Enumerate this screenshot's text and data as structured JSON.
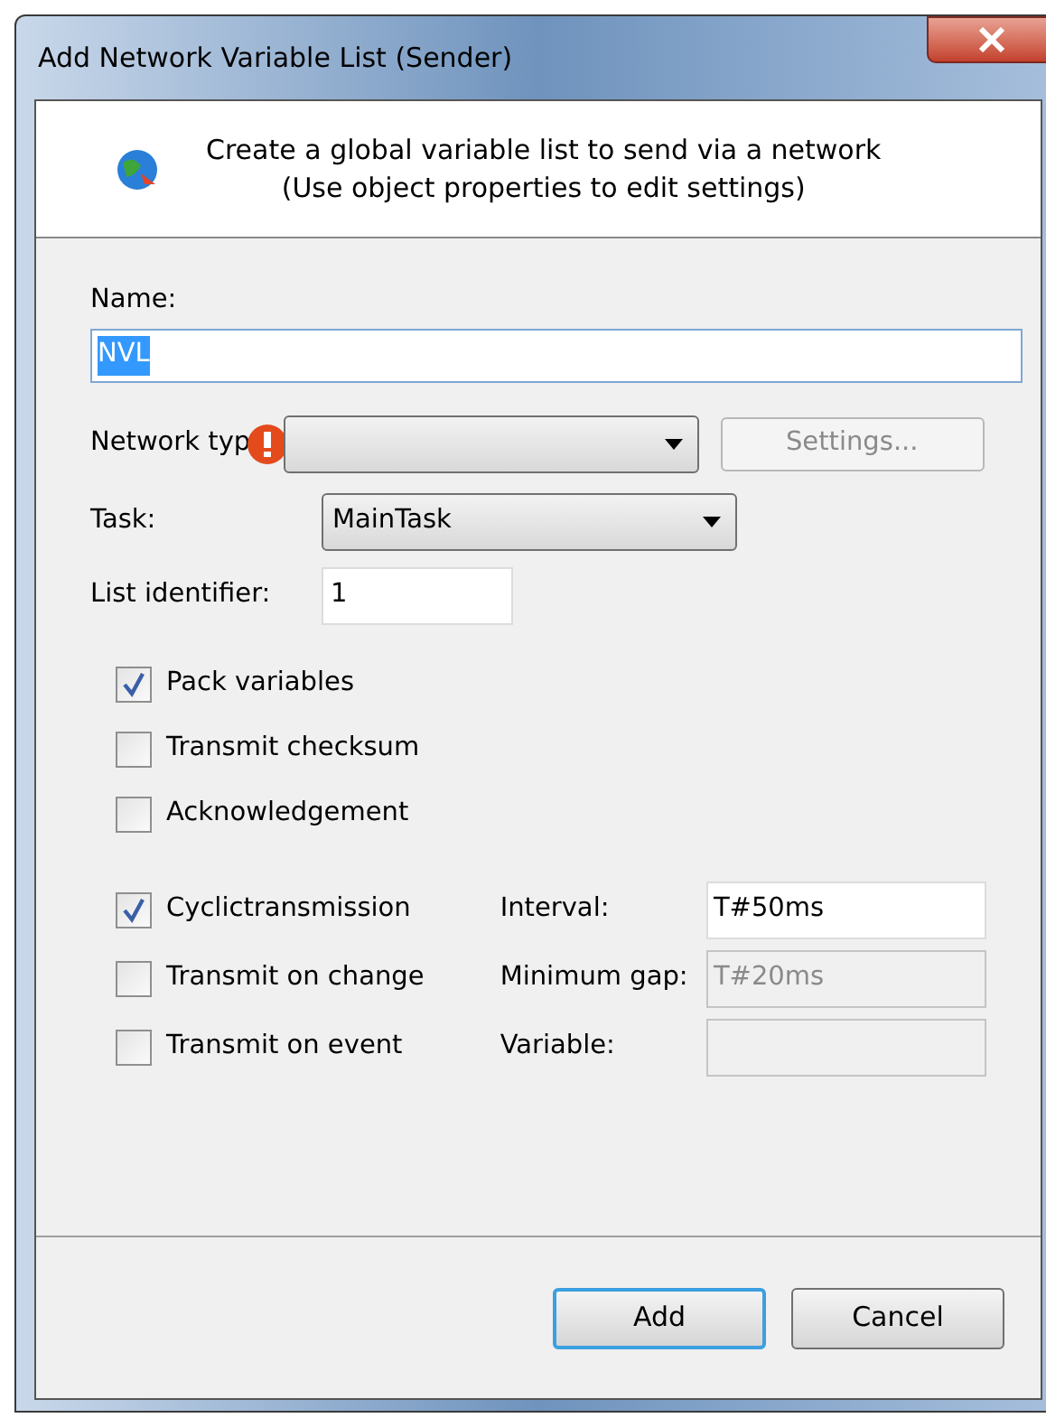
{
  "window": {
    "title": "Add Network Variable List (Sender)"
  },
  "header": {
    "lines": [
      "Create a global variable list to send via a network",
      "(Use object properties to edit settings)"
    ]
  },
  "name": {
    "label": "Name:",
    "value": "NVL",
    "selected": true
  },
  "network_type": {
    "label": "Network typ",
    "warning": true
  },
  "settings_button": {
    "label": "Settings...",
    "disabled": true
  },
  "task": {
    "label": "Task:",
    "value": "MainTask"
  },
  "list_identifier": {
    "label": "List identifier:",
    "value": "1"
  },
  "options": [
    {
      "label": "Pack variables",
      "checked": true
    },
    {
      "label": "Transmit checksum",
      "checked": false
    },
    {
      "label": "Acknowledgement",
      "checked": false
    }
  ],
  "transmission": [
    {
      "label": "Cyclictransmission",
      "checked": true,
      "field_label": "Interval:",
      "value": "T#50ms",
      "disabled": false
    },
    {
      "label": "Transmit on change",
      "checked": false,
      "field_label": "Minimum gap:",
      "value": "T#20ms",
      "disabled": true
    },
    {
      "label": "Transmit on event",
      "checked": false,
      "field_label": "Variable:",
      "disabled": true
    }
  ],
  "buttons": [
    {
      "label": "Add",
      "default": true
    },
    {
      "label": "Cancel",
      "default": false
    }
  ]
}
